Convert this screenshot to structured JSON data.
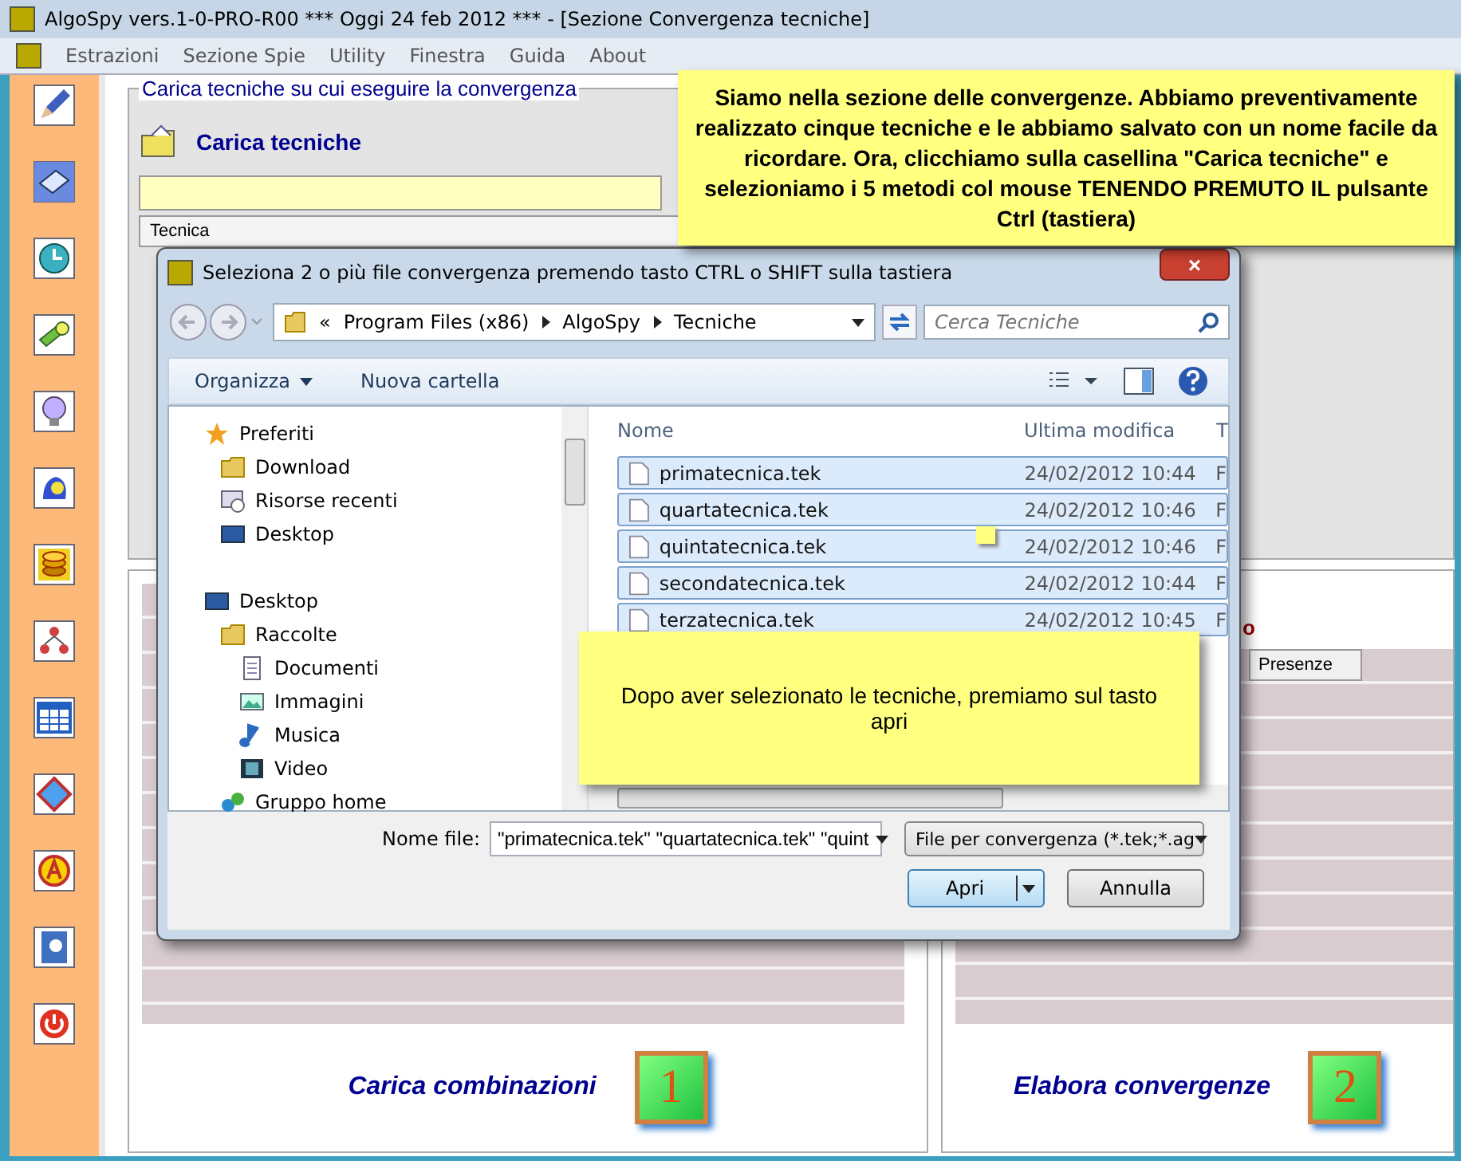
{
  "window": {
    "title": "AlgoSpy vers.1-0-PRO-R00  ***  Oggi 24 feb 2012  ***   - [Sezione Convergenza tecniche]"
  },
  "menu": [
    "Estrazioni",
    "Sezione Spie",
    "Utility",
    "Finestra",
    "Guida",
    "About"
  ],
  "top_panel": {
    "title": "Carica tecniche su cui eseguire la convergenza",
    "load_button": "Carica tecniche",
    "table_header": "Tecnica"
  },
  "left_panel": {
    "action": "Carica combinazioni",
    "badge": "1"
  },
  "right_panel": {
    "title_fragment": "o",
    "column": "Presenze",
    "action": "Elabora convergenze",
    "badge": "2"
  },
  "dialog": {
    "title": "Seleziona 2 o più file convergenza premendo tasto CTRL o SHIFT sulla tastiera",
    "close": "×",
    "breadcrumb": [
      "«",
      "Program Files (x86)",
      "AlgoSpy",
      "Tecniche"
    ],
    "search": {
      "placeholder": "Cerca Tecniche"
    },
    "commands": [
      "Organizza",
      "Nuova cartella"
    ],
    "nav": [
      {
        "label": "Preferiti",
        "children": [
          {
            "label": "Download"
          },
          {
            "label": "Risorse recenti"
          },
          {
            "label": "Desktop"
          }
        ]
      },
      {
        "label": "Desktop",
        "children": [
          {
            "label": "Raccolte",
            "children": [
              {
                "label": "Documenti"
              },
              {
                "label": "Immagini"
              },
              {
                "label": "Musica"
              },
              {
                "label": "Video"
              }
            ]
          },
          {
            "label": "Gruppo home"
          }
        ]
      }
    ],
    "columns": [
      "Nome",
      "Ultima modifica",
      "T"
    ],
    "files": [
      {
        "name": "primatecnica.tek",
        "modified": "24/02/2012 10:44",
        "type": "F",
        "selected": true
      },
      {
        "name": "quartatecnica.tek",
        "modified": "24/02/2012 10:46",
        "type": "F",
        "selected": true
      },
      {
        "name": "quintatecnica.tek",
        "modified": "24/02/2012 10:46",
        "type": "F",
        "selected": true
      },
      {
        "name": "secondatecnica.tek",
        "modified": "24/02/2012 10:44",
        "type": "F",
        "selected": true
      },
      {
        "name": "terzatecnica.tek",
        "modified": "24/02/2012 10:45",
        "type": "F",
        "selected": true
      }
    ],
    "filename_label": "Nome file:",
    "filename": "\"primatecnica.tek\" \"quartatecnica.tek\" \"quint",
    "filter": "File per convergenza (*.tek;*.ag",
    "open": "Apri",
    "cancel": "Annulla"
  },
  "callouts": [
    "Siamo nella sezione delle convergenze. Abbiamo preventivamente realizzato cinque tecniche e le abbiamo salvato con un nome facile da ricordare. Ora, clicchiamo sulla casellina \"Carica tecniche\" e selezioniamo i 5 metodi col mouse TENENDO PREMUTO IL pulsante Ctrl (tastiera)",
    "Dopo aver selezionato le tecniche, premiamo sul tasto apri"
  ]
}
